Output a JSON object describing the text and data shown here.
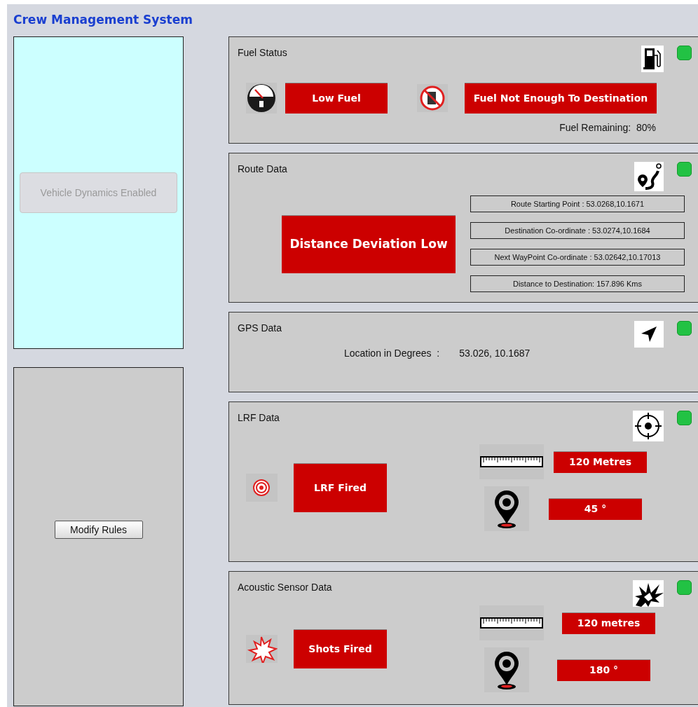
{
  "title": "Crew Management System",
  "vehicle_dynamics_button": {
    "label": "Vehicle Dynamics Enabled",
    "disabled": true
  },
  "modify_rules_button": {
    "label": "Modify Rules",
    "disabled": false
  },
  "panels": [
    {
      "kind": "fuel",
      "title": "Fuel Status",
      "indicator_on": true,
      "alerts": [
        "Low Fuel",
        "Fuel Not Enough To Destination"
      ],
      "remaining": "Fuel Remaining:  80%"
    },
    {
      "kind": "route",
      "title": "Route Data",
      "indicator_on": true,
      "alert": "Distance Deviation Low",
      "fields": [
        "Route Starting Point : 53.0268,10.1671",
        "Destination Co-ordinate : 53.0274,10.1684",
        "Next WayPoint Co-ordinate : 53.02642,10.17013",
        "Distance to Destination: 157.896 Kms"
      ]
    },
    {
      "kind": "gps",
      "title": "GPS Data",
      "indicator_on": true,
      "label": "Location in Degrees  :",
      "value": "53.026, 10.1687"
    },
    {
      "kind": "lrf",
      "title": "LRF Data",
      "indicator_on": true,
      "alert": "LRF Fired",
      "distance": "120 Metres",
      "angle": "45 °"
    },
    {
      "kind": "acoustic",
      "title": "Acoustic Sensor Data",
      "indicator_on": true,
      "alert": "Shots Fired",
      "distance": "120 metres",
      "angle": "180 °"
    }
  ]
}
